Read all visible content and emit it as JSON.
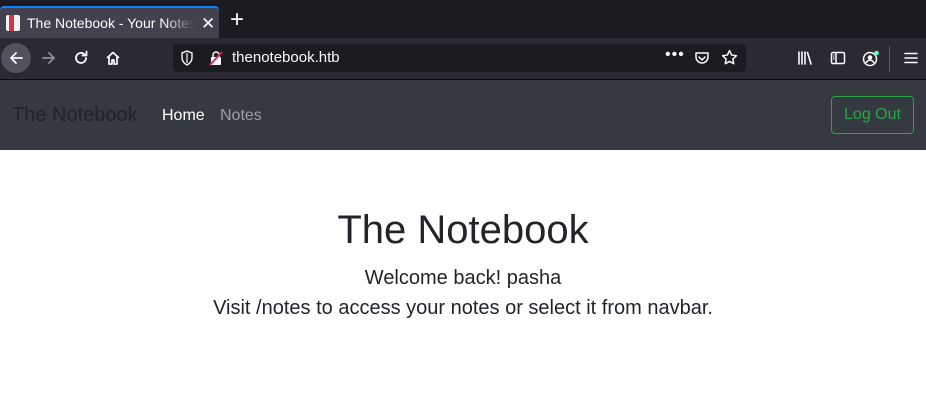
{
  "browser": {
    "tab": {
      "title": "The Notebook - Your Notes",
      "close": "✕"
    },
    "new_tab": "+",
    "url": "thenotebook.htb",
    "url_more": "•••",
    "accent": "#0a84ff"
  },
  "site": {
    "brand": "The Notebook",
    "nav": {
      "home": "Home",
      "notes": "Notes"
    },
    "logout": "Log Out",
    "navbar_color": "#343a40",
    "logout_color": "#28a745"
  },
  "hero": {
    "title": "The Notebook",
    "welcome": "Welcome back! pasha",
    "info": "Visit /notes to access your notes or select it from navbar."
  }
}
